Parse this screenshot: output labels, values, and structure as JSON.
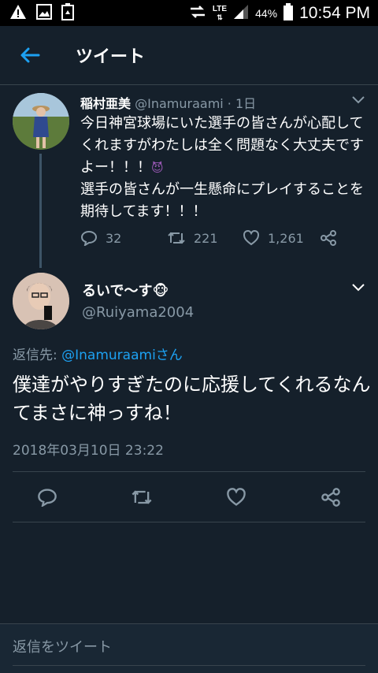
{
  "status_bar": {
    "icons_left": [
      "alert-icon",
      "image-icon",
      "recycle-battery-icon"
    ],
    "lte_label": "LTE",
    "battery_percent": "44%",
    "time": "10:54 PM"
  },
  "header": {
    "title": "ツイート"
  },
  "original_tweet": {
    "name": "稲村亜美",
    "handle_time": "@Inamuraami · 1日",
    "text_line1": "今日神宮球場にいた選手の皆さんが心配してくれますがわたしは全く問題なく大丈夫ですよー！！！",
    "emoji": "😈",
    "text_line2": "選手の皆さんが一生懸命にプレイすることを期待してます！！！",
    "reply_count": "32",
    "retweet_count": "221",
    "like_count": "1,261"
  },
  "reply_tweet": {
    "name": "るいで〜す🐵",
    "handle": "@Ruiyama2004",
    "reply_to_prefix": "返信先: ",
    "reply_to_mention": "@Inamuraamiさん",
    "text": "僕達がやりすぎたのに応援してくれるなんてまさに神っすね！",
    "timestamp": "2018年03月10日 23:22"
  },
  "reply_box": {
    "placeholder": "返信をツイート"
  },
  "colors": {
    "background": "#15202b",
    "accent": "#1da1f2",
    "secondary_text": "#8899a6",
    "divider": "#38444d"
  }
}
